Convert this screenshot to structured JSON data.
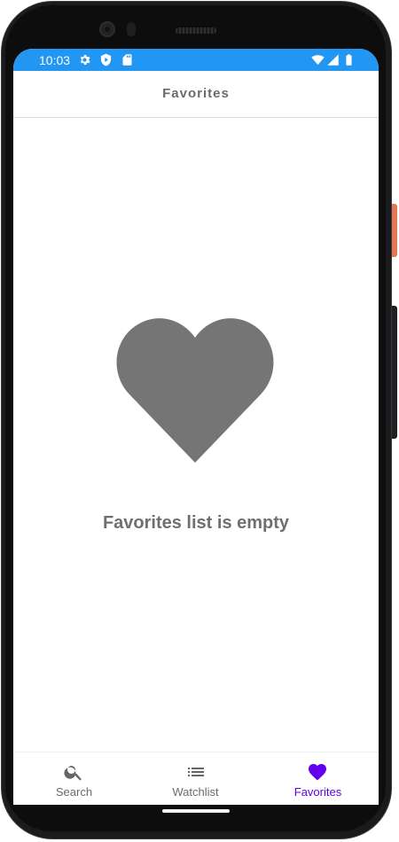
{
  "status_bar": {
    "time": "10:03",
    "background_color": "#2196f3",
    "left_icons": [
      "gear-icon",
      "shield-icon",
      "sd-card-icon"
    ],
    "right_icons": [
      "wifi-icon",
      "signal-icon",
      "battery-icon"
    ]
  },
  "app_bar": {
    "title": "Favorites"
  },
  "empty_state": {
    "icon": "heart-icon",
    "icon_color": "#757575",
    "message": "Favorites list is empty"
  },
  "bottom_nav": {
    "active_color": "#6200ee",
    "inactive_color": "#6b6b6b",
    "items": [
      {
        "label": "Search",
        "icon": "search-icon",
        "active": false
      },
      {
        "label": "Watchlist",
        "icon": "list-icon",
        "active": false
      },
      {
        "label": "Favorites",
        "icon": "heart-icon",
        "active": true
      }
    ]
  }
}
